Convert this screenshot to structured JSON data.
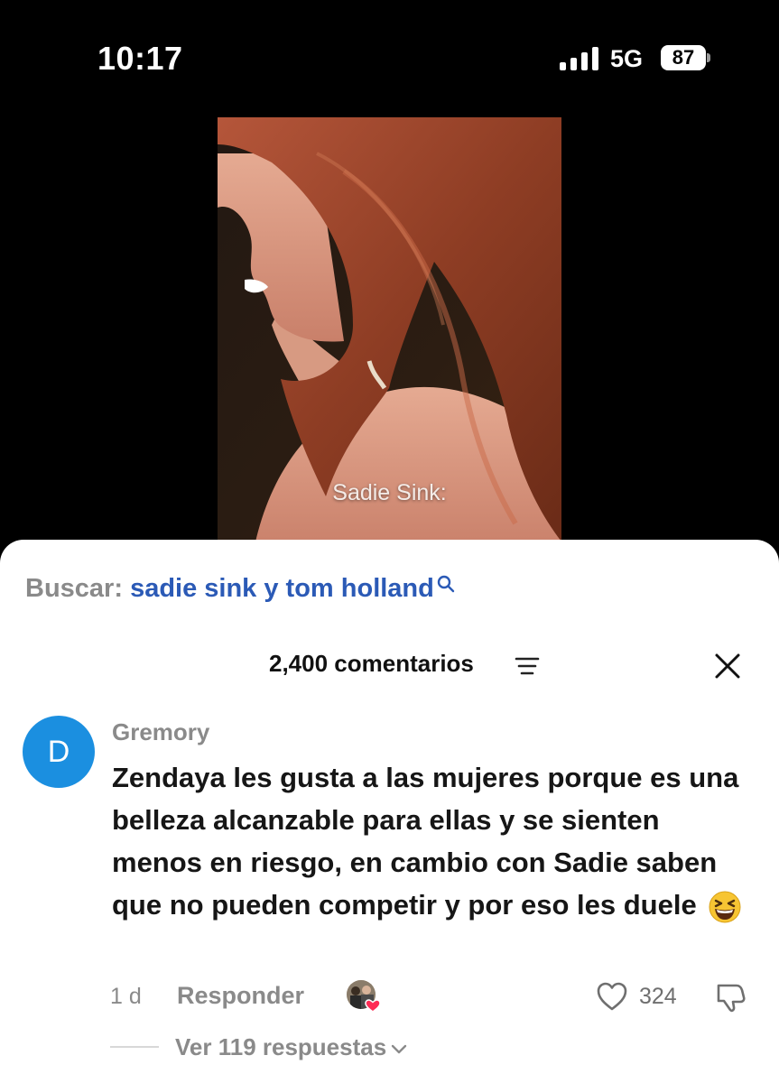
{
  "status_bar": {
    "time": "10:17",
    "network": "5G",
    "battery": "87"
  },
  "video": {
    "caption": "Sadie Sink:"
  },
  "search": {
    "label": "Buscar:",
    "query": "sadie sink y tom holland",
    "query_color": "#2b5ab6"
  },
  "comments_header": {
    "count_label": "2,400 comentarios"
  },
  "comment": {
    "avatar_letter": "D",
    "avatar_color": "#1b8fe0",
    "username": "Gremory",
    "text": "Zendaya les gusta a las mujeres porque es una belleza alcanzable para ellas y se sienten menos en riesgo, en cambio con Sadie saben que no pueden competir y por eso les duele",
    "emoji": "grinning-squinting-face",
    "timestamp": "1 d",
    "reply_label": "Responder",
    "likes": "324",
    "view_replies": "Ver 119 respuestas"
  },
  "icons": [
    "signal-icon",
    "battery-icon",
    "search-icon",
    "sort-icon",
    "close-icon",
    "heart-icon",
    "dislike-icon",
    "chevron-down-icon",
    "creator-liked-badge"
  ]
}
